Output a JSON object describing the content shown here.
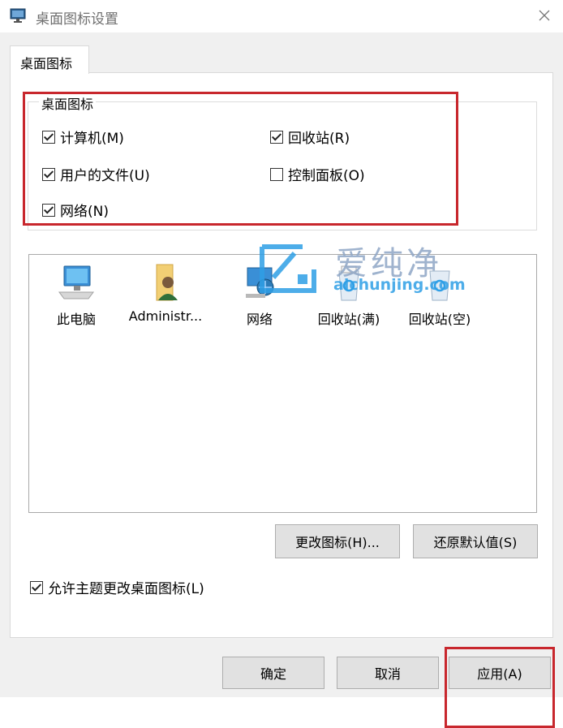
{
  "window": {
    "title": "桌面图标设置"
  },
  "tabs": [
    {
      "label": "桌面图标"
    }
  ],
  "group": {
    "title": "桌面图标",
    "checkboxes": [
      {
        "label": "计算机(M)",
        "checked": true
      },
      {
        "label": "回收站(R)",
        "checked": true
      },
      {
        "label": "用户的文件(U)",
        "checked": true
      },
      {
        "label": "控制面板(O)",
        "checked": false
      },
      {
        "label": "网络(N)",
        "checked": true
      }
    ]
  },
  "icons": [
    {
      "label": "此电脑",
      "icon": "monitor-icon"
    },
    {
      "label": "Administr...",
      "icon": "user-folder-icon"
    },
    {
      "label": "网络",
      "icon": "network-icon"
    },
    {
      "label": "回收站(满)",
      "icon": "recycle-bin-full-icon"
    },
    {
      "label": "回收站(空)",
      "icon": "recycle-bin-empty-icon"
    }
  ],
  "buttons": {
    "change_icon": "更改图标(H)...",
    "restore_default": "还原默认值(S)",
    "ok": "确定",
    "cancel": "取消",
    "apply": "应用(A)"
  },
  "allow_theme": {
    "label": "允许主题更改桌面图标(L)",
    "checked": true
  },
  "watermark": {
    "text": "爱纯净",
    "url": "aichunjing.com"
  },
  "colors": {
    "highlight": "#c8272d",
    "dialog_bg": "#f0f0f0",
    "button_bg": "#e1e1e1"
  }
}
